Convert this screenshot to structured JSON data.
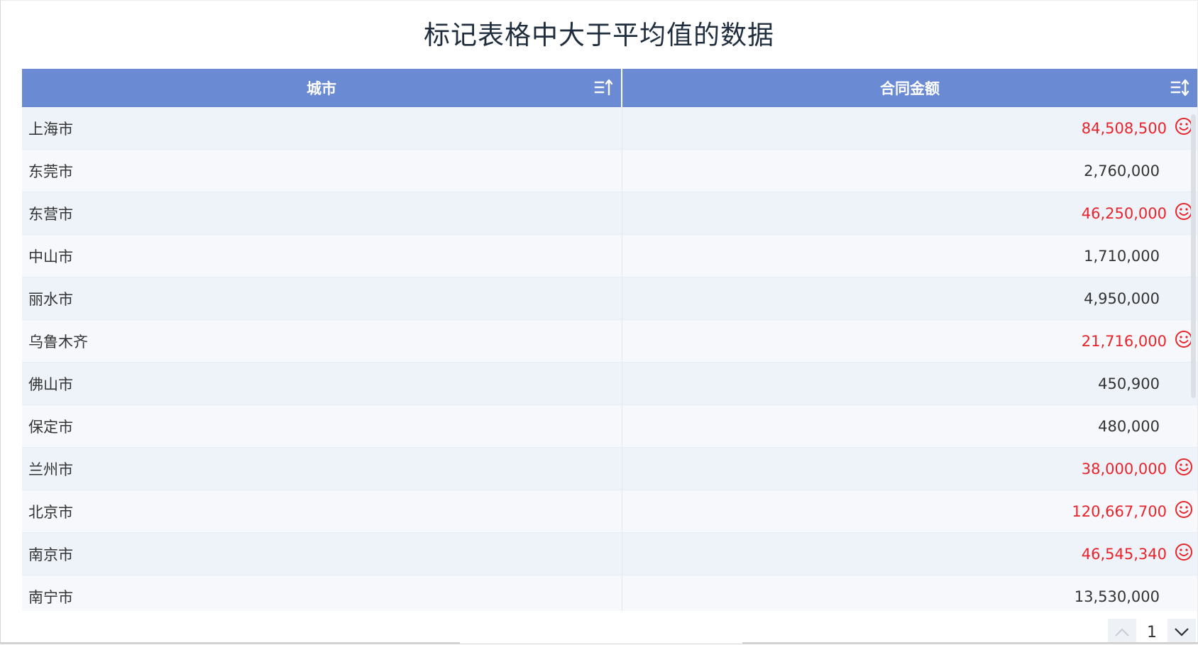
{
  "title": "标记表格中大于平均值的数据",
  "table": {
    "columns": [
      {
        "label": "城市",
        "sort_icon": "sort-ascending-icon"
      },
      {
        "label": "合同金额",
        "sort_icon": "sort-both-icon"
      }
    ],
    "rows": [
      {
        "city": "上海市",
        "amount": "84,508,500",
        "above_average": true
      },
      {
        "city": "东莞市",
        "amount": "2,760,000",
        "above_average": false
      },
      {
        "city": "东营市",
        "amount": "46,250,000",
        "above_average": true
      },
      {
        "city": "中山市",
        "amount": "1,710,000",
        "above_average": false
      },
      {
        "city": "丽水市",
        "amount": "4,950,000",
        "above_average": false
      },
      {
        "city": "乌鲁木齐",
        "amount": "21,716,000",
        "above_average": true
      },
      {
        "city": "佛山市",
        "amount": "450,900",
        "above_average": false
      },
      {
        "city": "保定市",
        "amount": "480,000",
        "above_average": false
      },
      {
        "city": "兰州市",
        "amount": "38,000,000",
        "above_average": true
      },
      {
        "city": "北京市",
        "amount": "120,667,700",
        "above_average": true
      },
      {
        "city": "南京市",
        "amount": "46,545,340",
        "above_average": true
      },
      {
        "city": "南宁市",
        "amount": "13,530,000",
        "above_average": false
      },
      {
        "city": "",
        "amount": "",
        "above_average": false
      }
    ]
  },
  "highlight_color": "#e8242b",
  "header_color": "#6a8ad4",
  "highlight_icon": "smile-icon",
  "pager": {
    "current_page": "1"
  }
}
